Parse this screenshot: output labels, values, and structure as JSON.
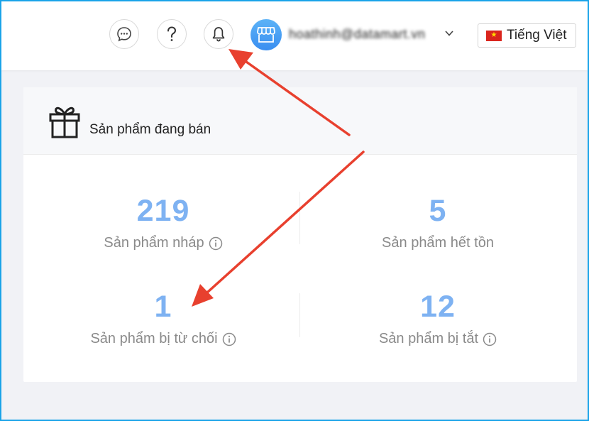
{
  "header": {
    "chat_icon": "chat-bubble-icon",
    "help_icon": "question-mark-icon",
    "notification_icon": "bell-icon",
    "shop_icon": "shop-storefront-icon",
    "account_name": "hoathinh@datamart.vn",
    "language": {
      "label": "Tiếng Việt",
      "flag_icon": "vietnam-flag-icon"
    }
  },
  "card": {
    "icon": "gift-icon",
    "title": "Sản phẩm đang bán",
    "stats": [
      {
        "value": "219",
        "label": "Sản phẩm nháp",
        "info": true
      },
      {
        "value": "5",
        "label": "Sản phẩm hết tồn",
        "info": false
      },
      {
        "value": "1",
        "label": "Sản phẩm bị từ chối",
        "info": true
      },
      {
        "value": "12",
        "label": "Sản phẩm bị tắt",
        "info": true
      }
    ]
  },
  "colors": {
    "accent_number": "#7eb2f2",
    "annotation_arrow": "#e8402e",
    "frame_border": "#1aa3e8"
  }
}
